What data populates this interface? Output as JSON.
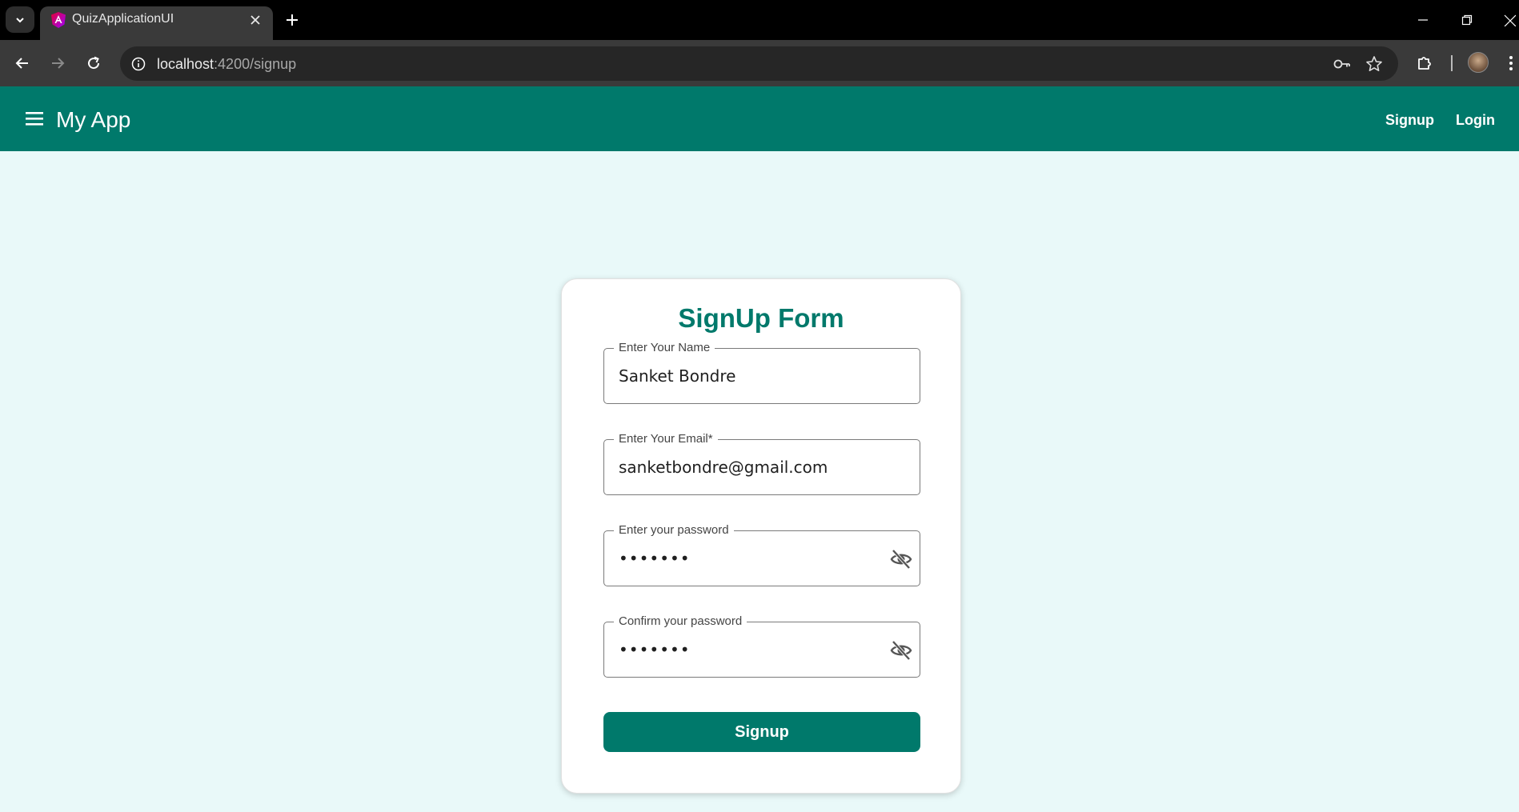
{
  "browser": {
    "tab_title": "QuizApplicationUI",
    "url_host": "localhost",
    "url_path": ":4200/signup"
  },
  "header": {
    "app_title": "My App",
    "nav": [
      {
        "label": "Signup"
      },
      {
        "label": "Login"
      }
    ]
  },
  "form": {
    "title": "SignUp Form",
    "fields": {
      "name": {
        "label": "Enter Your Name",
        "value": "Sanket Bondre"
      },
      "email": {
        "label": "Enter Your Email*",
        "value": "sanketbondre@gmail.com"
      },
      "password": {
        "label": "Enter your password",
        "value": "•••••••"
      },
      "confirm_password": {
        "label": "Confirm your password",
        "value": "•••••••"
      }
    },
    "submit_label": "Signup"
  },
  "colors": {
    "primary": "#00796b",
    "background": "#e9f9f9",
    "card": "#ffffff"
  },
  "icons": [
    "menu-icon",
    "eye-off-icon",
    "key-icon",
    "star-icon",
    "extensions-icon",
    "back-icon",
    "forward-icon",
    "reload-icon",
    "info-icon"
  ]
}
